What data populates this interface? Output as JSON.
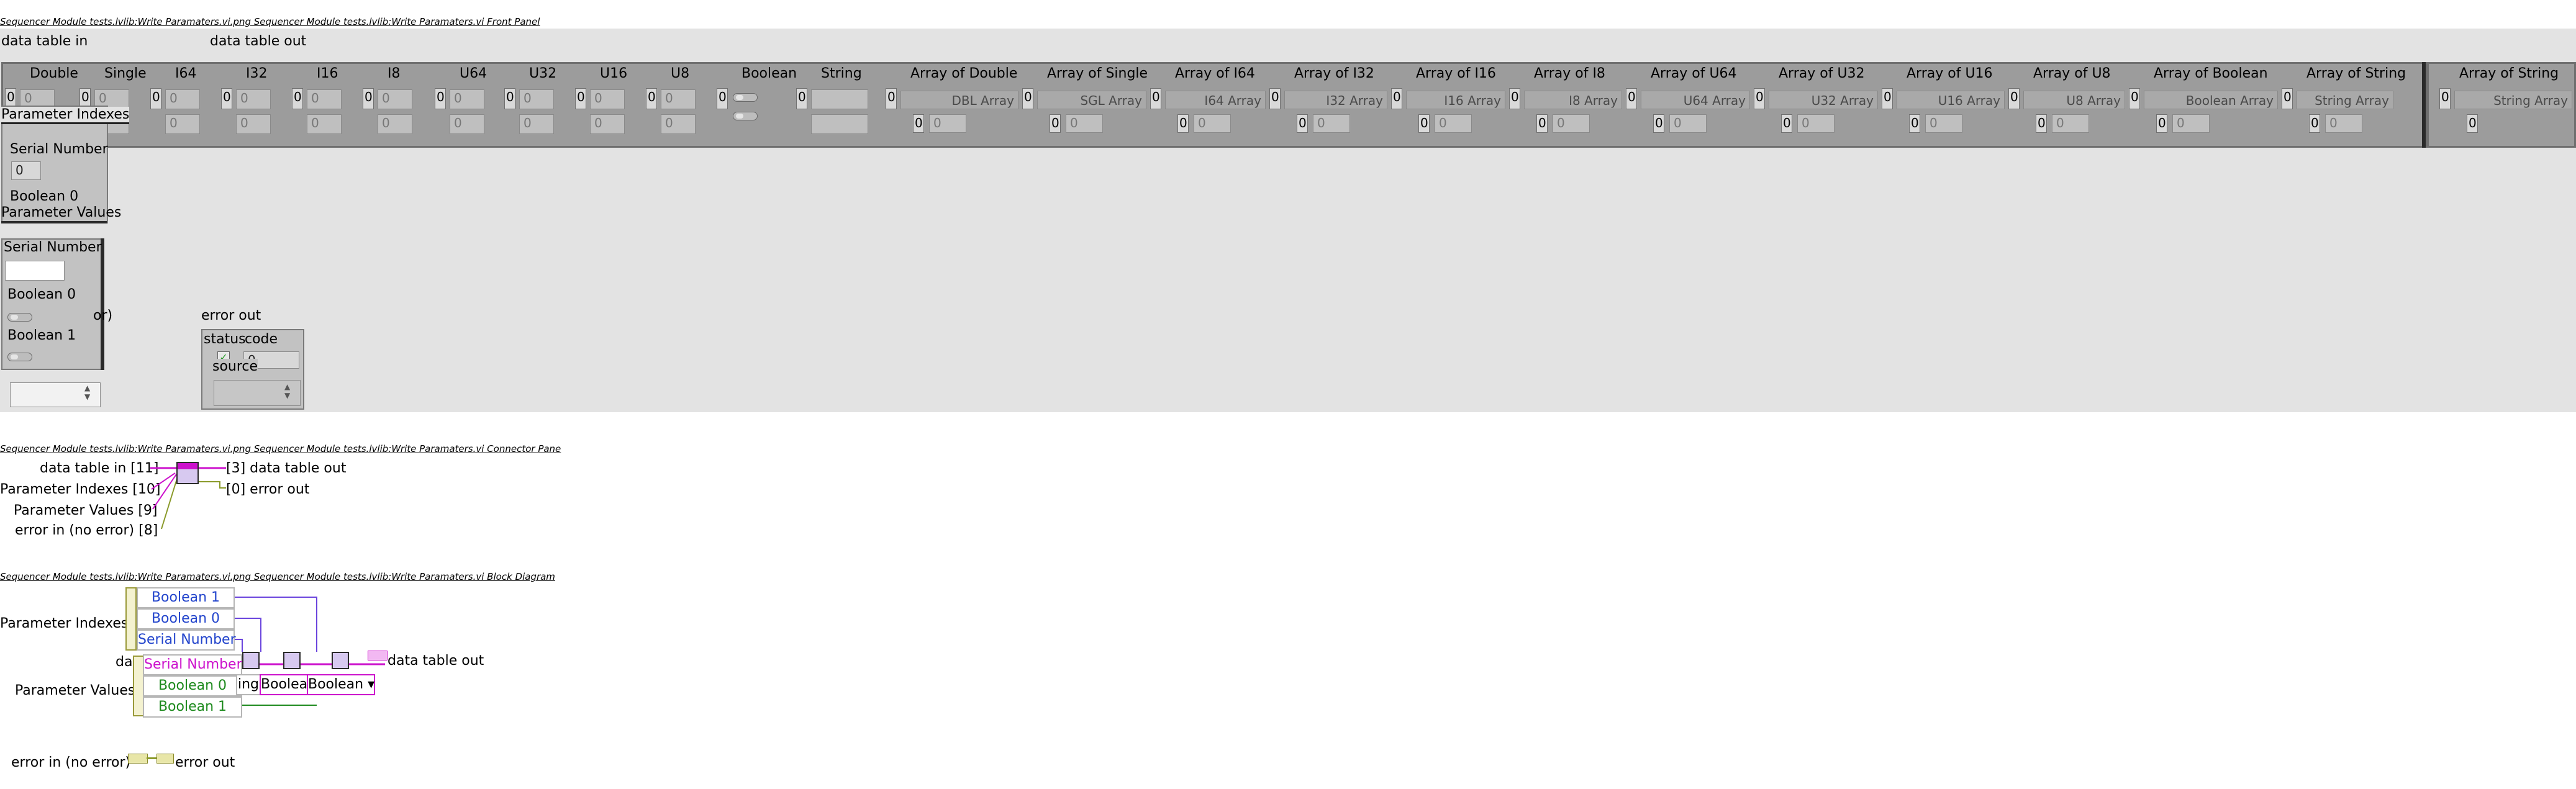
{
  "front_panel": {
    "title": "Sequencer Module tests.lvlib:Write Paramaters.vi.png  Sequencer Module tests.lvlib:Write Paramaters.vi Front Panel",
    "data_table_in_label": "data table in",
    "data_table_out_label": "data table out",
    "columns": [
      "Double",
      "Single",
      "I64",
      "I32",
      "I16",
      "I8",
      "U64",
      "U32",
      "U16",
      "U8",
      "Boolean",
      "String",
      "Array of Double",
      "Array of Single",
      "Array of I64",
      "Array of I32",
      "Array of I16",
      "Array of I8",
      "Array of U64",
      "Array of U32",
      "Array of U16",
      "Array of U8",
      "Array of Boolean",
      "Array of String"
    ],
    "array_columns": [
      "DBL Array",
      "SGL Array",
      "I64 Array",
      "I32 Array",
      "I16 Array",
      "I8 Array",
      "U64 Array",
      "U32 Array",
      "U16 Array",
      "U8 Array",
      "Boolean Array",
      "String Array"
    ],
    "out_column": "Array of String",
    "out_array": "String Array",
    "zero": "0",
    "parameter_indexes_label": "Parameter Indexes",
    "parameter_values_label": "Parameter Values",
    "serial_number_label": "Serial Number",
    "boolean0_label": "Boolean 0",
    "boolean1_label": "Boolean 1",
    "error_in_label": "or)",
    "error_out_label": "error out",
    "status_label": "status",
    "code_label": "code",
    "source_label": "source",
    "source_clipped": "source",
    "check_mark": "✓"
  },
  "connector_pane": {
    "title": "Sequencer Module tests.lvlib:Write Paramaters.vi.png  Sequencer Module tests.lvlib:Write Paramaters.vi Connector Pane",
    "inputs": [
      "data table in [11]",
      "Parameter Indexes [10]",
      "Parameter Values [9]",
      "error in (no error) [8]"
    ],
    "outputs": [
      "[3] data table out",
      "[0] error out"
    ]
  },
  "block_diagram": {
    "title": "Sequencer Module tests.lvlib:Write Paramaters.vi.png  Sequencer Module tests.lvlib:Write Paramaters.vi Block Diagram",
    "parameter_indexes": "Parameter Indexes",
    "parameter_values": "Parameter Values",
    "index_items": [
      "Boolean 1",
      "Boolean 0",
      "Serial Number"
    ],
    "value_items": [
      "Serial Number",
      "Boolean 0",
      "Boolean 1"
    ],
    "data_prefix": "dat",
    "string_clip": "ing",
    "boolean_clip": "Boolea",
    "boolean_full": "Boolean",
    "data_table_out": "data table out",
    "error_in": "error in (no error)",
    "error_out": "error out"
  }
}
